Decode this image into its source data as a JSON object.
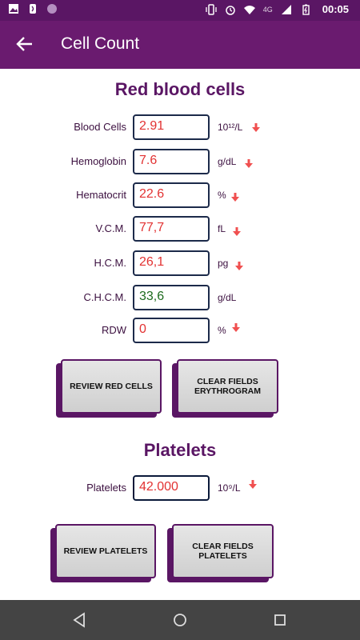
{
  "status_bar": {
    "time": "00:05",
    "network": "4G",
    "icons": [
      "gallery-icon",
      "phone-icon",
      "circle-icon",
      "vibrate-icon",
      "alarm-icon",
      "wifi-icon",
      "signal-icon",
      "battery-icon"
    ]
  },
  "app_bar": {
    "title": "Cell Count",
    "back_icon": "arrow-back-icon"
  },
  "red_cells": {
    "heading": "Red blood cells",
    "rows": [
      {
        "label": "Blood Cells",
        "value": "2.91",
        "unit": "10¹²/L",
        "status": "low"
      },
      {
        "label": "Hemoglobin",
        "value": "7.6",
        "unit": "g/dL",
        "status": "low"
      },
      {
        "label": "Hematocrit",
        "value": "22.6",
        "unit": "%",
        "status": "low"
      },
      {
        "label": "V.C.M.",
        "value": "77,7",
        "unit": "fL",
        "status": "low"
      },
      {
        "label": "H.C.M.",
        "value": "26,1",
        "unit": "pg",
        "status": "low"
      },
      {
        "label": "C.H.C.M.",
        "value": "33,6",
        "unit": "g/dL",
        "status": "normal"
      },
      {
        "label": "RDW",
        "value": "0",
        "unit": "%",
        "status": "low"
      }
    ],
    "review_button": "REVIEW RED CELLS",
    "clear_button": "CLEAR FIELDS ERYTHROGRAM"
  },
  "platelets": {
    "heading": "Platelets",
    "label": "Platelets",
    "value": "42.000",
    "unit": "10⁹/L",
    "status": "low",
    "review_button": "REVIEW PLATELETS",
    "clear_button": "CLEAR FIELDS PLATELETS"
  },
  "colors": {
    "primary": "#6a1b6f",
    "low_value": "#e23232",
    "normal_value": "#1d6b1d",
    "arrow": "#f05050"
  }
}
